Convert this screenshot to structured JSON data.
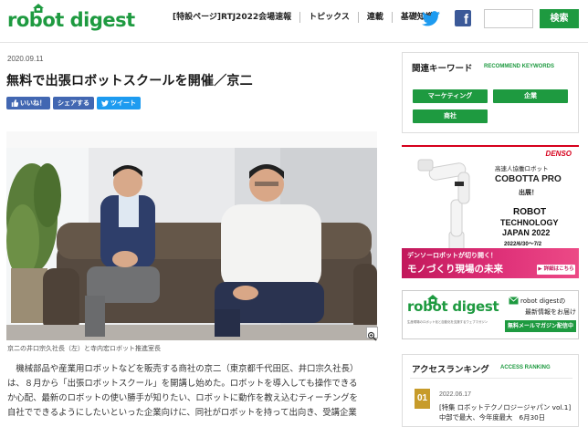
{
  "header": {
    "logo_text": "robot digest",
    "nav": [
      "[特設ページ]RTJ2022会場速報",
      "トピックス",
      "連載",
      "基礎知識"
    ],
    "search_placeholder": "",
    "search_button": "検索"
  },
  "article": {
    "date": "2020.09.11",
    "title": "無料で出張ロボットスクールを開催／京二",
    "social": {
      "like": "いいね！",
      "share": "シェアする",
      "tweet": "ツイート"
    },
    "caption": "京二の井口宗久社長（左）と寺内宏ロボット推進室長",
    "body_lines": [
      "機械部品や産業用ロボットなどを販売する商社の京二（東京都千代田区、井口宗久社長）",
      "は、８月から「出張ロボットスクール」を開講し始めた。ロボットを導入しても操作できる",
      "か心配、最新のロボットの使い勝手が知りたい、ロボットに動作を教え込むティーチングを",
      "自社でできるようにしたいといった企業向けに、同社がロボットを持って出向き、受講企業"
    ]
  },
  "sidebar": {
    "keywords": {
      "title": "関連キーワード",
      "subtitle": "RECOMMEND KEYWORDS",
      "tags": [
        "マーケティング",
        "企業",
        "商社"
      ]
    },
    "ad_denso": {
      "brand": "DENSO",
      "line1": "高速人協働ロボット",
      "product": "COBOTTA PRO",
      "line3": "出展！",
      "event1": "ROBOT",
      "event2": "TECHNOLOGY",
      "event3": "JAPAN 2022",
      "dates": "2022/6/30〜7/2",
      "banner1": "デンソーロボットが切り開く！",
      "banner2": "モノづくり現場の未来",
      "cta": "▶ 詳細はこちら"
    },
    "ad_newsletter": {
      "logo": "robot digest",
      "tagline": "生産現場のロボット化と自動化を支援するウェブマガジン",
      "text1": "robot digestの",
      "text2": "最新情報をお届け",
      "cta": "無料メールマガジン配信中"
    },
    "ranking": {
      "title": "アクセスランキング",
      "subtitle": "ACCESS RANKING",
      "items": [
        {
          "rank": "01",
          "date": "2022.06.17",
          "text": "[特集 ロボットテクノロジージャパン vol.1]中部で最大、今年度最大　6月30日"
        }
      ]
    }
  },
  "colors": {
    "brand_green": "#1e9a40",
    "twitter": "#1d9bf0",
    "facebook": "#3b5998",
    "denso_red": "#d6001c",
    "denso_pink": "#e0337a",
    "rank_gold": "#c79b2a"
  }
}
